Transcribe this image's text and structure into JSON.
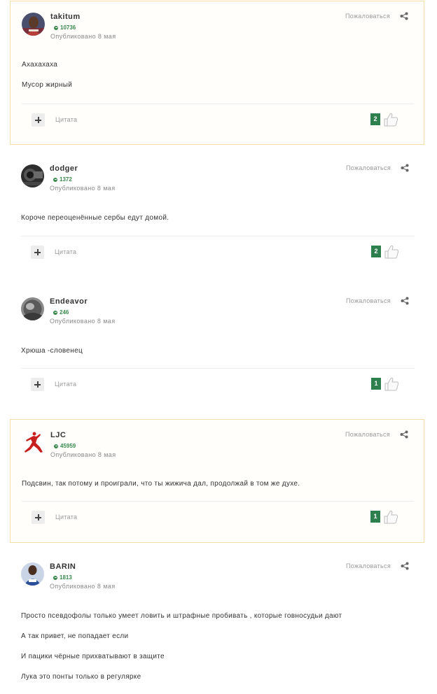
{
  "posts": [
    {
      "author": "takitum",
      "reputation": "10736",
      "date": "Опубликовано 8 мая",
      "report_label": "Пожаловаться",
      "paragraphs": [
        "Ахахахаха",
        "Мусор жирный"
      ],
      "quote_label": "Цитата",
      "likes": "2",
      "highlighted": true
    },
    {
      "author": "dodger",
      "reputation": "1372",
      "date": "Опубликовано 8 мая",
      "report_label": "Пожаловаться",
      "paragraphs": [
        "Короче переоценённые сербы едут домой."
      ],
      "quote_label": "Цитата",
      "likes": "2",
      "highlighted": false
    },
    {
      "author": "Endeavor",
      "reputation": "246",
      "date": "Опубликовано 8 мая",
      "report_label": "Пожаловаться",
      "paragraphs": [
        "Хрюша -словенец"
      ],
      "quote_label": "Цитата",
      "likes": "1",
      "highlighted": false
    },
    {
      "author": "LJC",
      "reputation": "45959",
      "date": "Опубликовано 8 мая",
      "report_label": "Пожаловаться",
      "paragraphs": [
        "Подсвин, так потому и проиграли, что ты жижича дал, продолжай в том же духе."
      ],
      "quote_label": "Цитата",
      "likes": "1",
      "highlighted": true
    },
    {
      "author": "BARIN",
      "reputation": "1813",
      "date": "Опубликовано 8 мая",
      "report_label": "Пожаловаться",
      "paragraphs": [
        "Просто псевдофолы только умеет ловить и штрафные пробивать , которые говносудьи дают",
        "А так привет, не попадает если",
        "И пацики чёрные прихватывают в защите",
        "Лука это понты только в регулярке"
      ],
      "highlighted": false
    }
  ],
  "colors": {
    "highlight_border": "#f5dfa6",
    "reputation_green": "#3a8a4e",
    "like_badge": "#2d7f4e"
  },
  "icons": {
    "share": "share-icon",
    "plus": "plus-icon",
    "like": "thumbs-up-icon",
    "reputation": "reputation-icon"
  }
}
